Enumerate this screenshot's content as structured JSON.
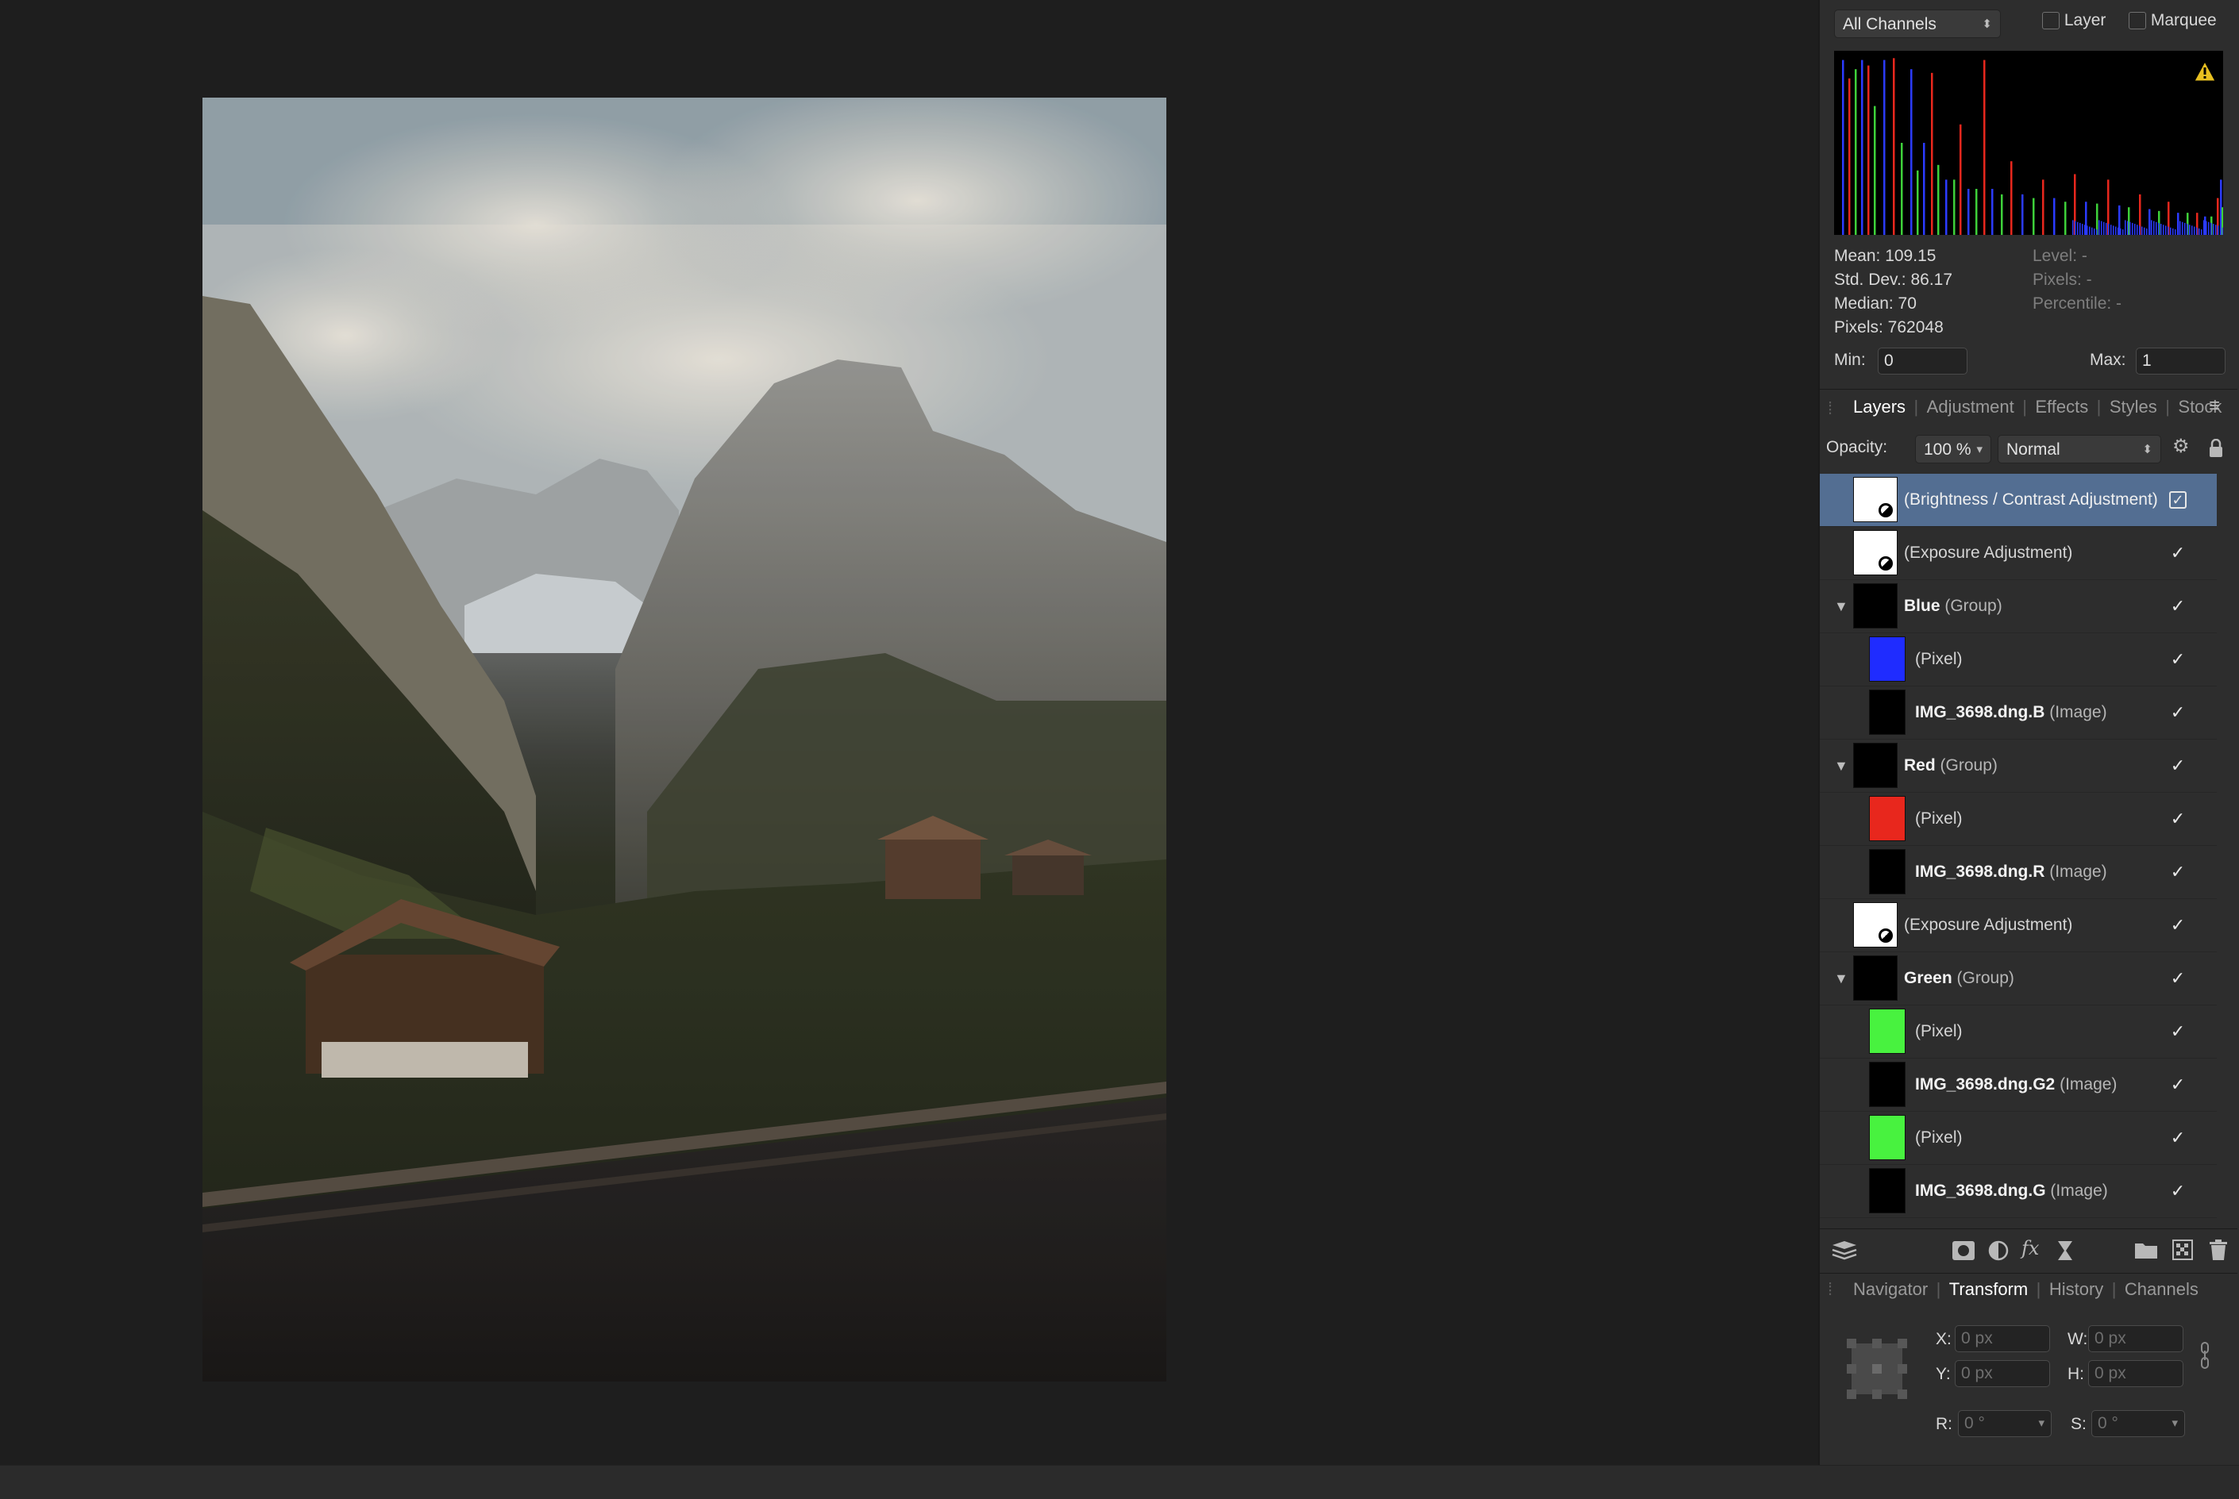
{
  "histogram": {
    "channel_select": "All Channels",
    "layer_checkbox_label": "Layer",
    "marquee_checkbox_label": "Marquee",
    "warning_icon": "warning-triangle-icon",
    "stats_left": [
      "Mean: 109.15",
      "Std. Dev.: 86.17",
      "Median: 70",
      "Pixels: 762048"
    ],
    "stats_right": [
      "Level: -",
      "Pixels: -",
      "Percentile: -"
    ],
    "min_label": "Min:",
    "min_value": "0",
    "max_label": "Max:",
    "max_value": "1",
    "colors": {
      "red": "#e8271d",
      "green": "#3ed13a",
      "blue": "#2b3bff"
    }
  },
  "studio_tabs": [
    "Layers",
    "Adjustment",
    "Effects",
    "Styles",
    "Stock"
  ],
  "active_studio_tab": "Layers",
  "layer_controls": {
    "opacity_label": "Opacity:",
    "opacity_value": "100 %",
    "blend_mode": "Normal"
  },
  "layers": [
    {
      "name": "(Brightness / Contrast Adjustment)",
      "type": "",
      "thumb": "adjustment",
      "selected": true,
      "checked": true
    },
    {
      "name": "(Exposure Adjustment)",
      "type": "",
      "thumb": "adjustment",
      "checked": true
    },
    {
      "name": "Blue",
      "type": "(Group)",
      "thumb": "black",
      "group": true,
      "checked": true
    },
    {
      "name": "(Pixel)",
      "type": "",
      "thumb": "blue",
      "child": true,
      "checked": true
    },
    {
      "name": "IMG_3698.dng.B",
      "type": "(Image)",
      "thumb": "black",
      "child": true,
      "checked": true
    },
    {
      "name": "Red",
      "type": "(Group)",
      "thumb": "black",
      "group": true,
      "checked": true
    },
    {
      "name": "(Pixel)",
      "type": "",
      "thumb": "red",
      "child": true,
      "checked": true
    },
    {
      "name": "IMG_3698.dng.R",
      "type": "(Image)",
      "thumb": "black",
      "child": true,
      "checked": true
    },
    {
      "name": "(Exposure Adjustment)",
      "type": "",
      "thumb": "adjustment",
      "checked": true
    },
    {
      "name": "Green",
      "type": "(Group)",
      "thumb": "black",
      "group": true,
      "checked": true
    },
    {
      "name": "(Pixel)",
      "type": "",
      "thumb": "green",
      "child": true,
      "checked": true
    },
    {
      "name": "IMG_3698.dng.G2",
      "type": "(Image)",
      "thumb": "black",
      "child": true,
      "checked": true
    },
    {
      "name": "(Pixel)",
      "type": "",
      "thumb": "green",
      "child": true,
      "checked": true
    },
    {
      "name": "IMG_3698.dng.G",
      "type": "(Image)",
      "thumb": "black",
      "child": true,
      "checked": true
    }
  ],
  "thumb_colors": {
    "adjustment": "#ffffff",
    "black": "#000000",
    "blue": "#1f2cff",
    "red": "#e8271d",
    "green": "#48f23f"
  },
  "layers_toolbar_icons": [
    "layers-stack-icon",
    "mask-icon",
    "adjustment-icon",
    "fx-icon",
    "live-filter-icon",
    "folder-icon",
    "pixel-layer-icon",
    "trash-icon"
  ],
  "bottom_tabs": [
    "Navigator",
    "Transform",
    "History",
    "Channels"
  ],
  "active_bottom_tab": "Transform",
  "transform": {
    "x_label": "X:",
    "x_placeholder": "0 px",
    "y_label": "Y:",
    "y_placeholder": "0 px",
    "w_label": "W:",
    "w_placeholder": "0 px",
    "h_label": "H:",
    "h_placeholder": "0 px",
    "r_label": "R:",
    "r_placeholder": "0 °",
    "s_label": "S:",
    "s_placeholder": "0 °"
  }
}
